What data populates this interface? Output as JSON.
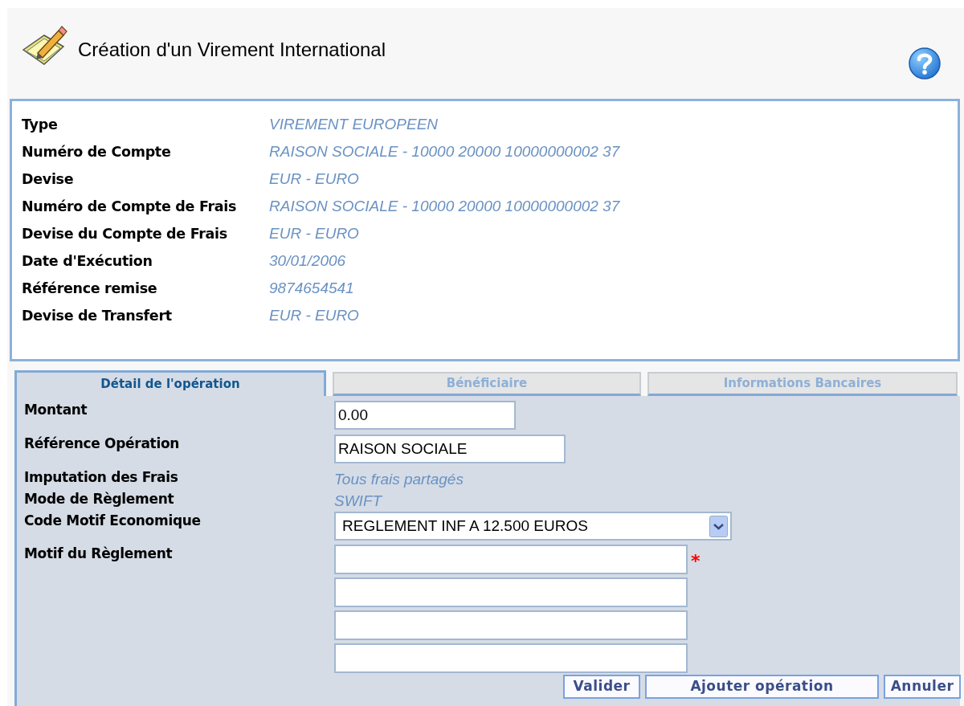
{
  "header": {
    "title": "Création d'un Virement International"
  },
  "summary": [
    {
      "label": "Type",
      "value": "VIREMENT EUROPEEN"
    },
    {
      "label": "Numéro de Compte",
      "value": "RAISON SOCIALE - 10000 20000 10000000002 37"
    },
    {
      "label": "Devise",
      "value": "EUR - EURO"
    },
    {
      "label": "Numéro de Compte de Frais",
      "value": "RAISON SOCIALE - 10000 20000 10000000002 37"
    },
    {
      "label": "Devise du Compte de Frais",
      "value": "EUR - EURO"
    },
    {
      "label": "Date d'Exécution",
      "value": "30/01/2006"
    },
    {
      "label": "Référence remise",
      "value": "9874654541"
    },
    {
      "label": "Devise de Transfert",
      "value": "EUR - EURO"
    }
  ],
  "tabs": [
    {
      "label": "Détail de l'opération",
      "selected": true
    },
    {
      "label": "Bénéficiaire",
      "selected": false
    },
    {
      "label": "Informations Bancaires",
      "selected": false
    }
  ],
  "form": [
    {
      "kind": "input",
      "label": "Montant",
      "value": "0.00"
    },
    {
      "kind": "input",
      "label": "Référence Opération",
      "value": "RAISON SOCIALE"
    },
    {
      "kind": "text",
      "label": "Imputation des Frais",
      "value": "Tous frais partagés"
    },
    {
      "kind": "text",
      "label": "Mode de Règlement",
      "value": "SWIFT"
    },
    {
      "kind": "select",
      "label": "Code Motif Economique",
      "value": "REGLEMENT INF A 12.500 EUROS"
    },
    {
      "kind": "lines",
      "label": "Motif du Règlement",
      "required_mark": "*",
      "fields": [
        {
          "required": true
        },
        {
          "required": false
        },
        {
          "required": false
        },
        {
          "required": false
        }
      ]
    }
  ],
  "buttons": [
    {
      "label": "Valider"
    },
    {
      "label": "Ajouter opération"
    },
    {
      "label": "Annuler"
    }
  ]
}
